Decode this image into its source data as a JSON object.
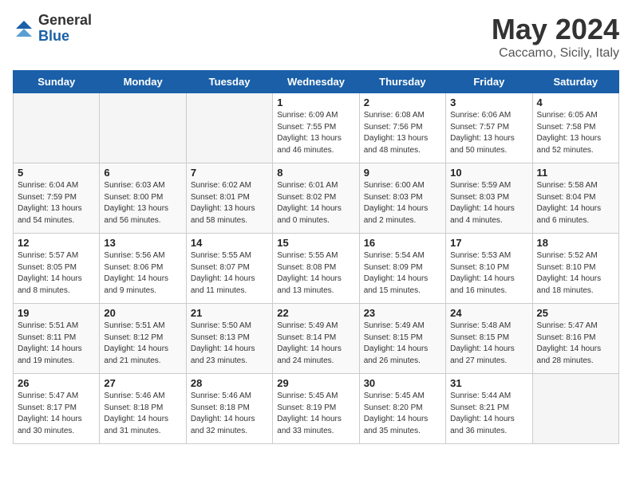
{
  "logo": {
    "general": "General",
    "blue": "Blue"
  },
  "title": "May 2024",
  "subtitle": "Caccamo, Sicily, Italy",
  "headers": [
    "Sunday",
    "Monday",
    "Tuesday",
    "Wednesday",
    "Thursday",
    "Friday",
    "Saturday"
  ],
  "weeks": [
    [
      {
        "day": "",
        "detail": ""
      },
      {
        "day": "",
        "detail": ""
      },
      {
        "day": "",
        "detail": ""
      },
      {
        "day": "1",
        "detail": "Sunrise: 6:09 AM\nSunset: 7:55 PM\nDaylight: 13 hours\nand 46 minutes."
      },
      {
        "day": "2",
        "detail": "Sunrise: 6:08 AM\nSunset: 7:56 PM\nDaylight: 13 hours\nand 48 minutes."
      },
      {
        "day": "3",
        "detail": "Sunrise: 6:06 AM\nSunset: 7:57 PM\nDaylight: 13 hours\nand 50 minutes."
      },
      {
        "day": "4",
        "detail": "Sunrise: 6:05 AM\nSunset: 7:58 PM\nDaylight: 13 hours\nand 52 minutes."
      }
    ],
    [
      {
        "day": "5",
        "detail": "Sunrise: 6:04 AM\nSunset: 7:59 PM\nDaylight: 13 hours\nand 54 minutes."
      },
      {
        "day": "6",
        "detail": "Sunrise: 6:03 AM\nSunset: 8:00 PM\nDaylight: 13 hours\nand 56 minutes."
      },
      {
        "day": "7",
        "detail": "Sunrise: 6:02 AM\nSunset: 8:01 PM\nDaylight: 13 hours\nand 58 minutes."
      },
      {
        "day": "8",
        "detail": "Sunrise: 6:01 AM\nSunset: 8:02 PM\nDaylight: 14 hours\nand 0 minutes."
      },
      {
        "day": "9",
        "detail": "Sunrise: 6:00 AM\nSunset: 8:03 PM\nDaylight: 14 hours\nand 2 minutes."
      },
      {
        "day": "10",
        "detail": "Sunrise: 5:59 AM\nSunset: 8:03 PM\nDaylight: 14 hours\nand 4 minutes."
      },
      {
        "day": "11",
        "detail": "Sunrise: 5:58 AM\nSunset: 8:04 PM\nDaylight: 14 hours\nand 6 minutes."
      }
    ],
    [
      {
        "day": "12",
        "detail": "Sunrise: 5:57 AM\nSunset: 8:05 PM\nDaylight: 14 hours\nand 8 minutes."
      },
      {
        "day": "13",
        "detail": "Sunrise: 5:56 AM\nSunset: 8:06 PM\nDaylight: 14 hours\nand 9 minutes."
      },
      {
        "day": "14",
        "detail": "Sunrise: 5:55 AM\nSunset: 8:07 PM\nDaylight: 14 hours\nand 11 minutes."
      },
      {
        "day": "15",
        "detail": "Sunrise: 5:55 AM\nSunset: 8:08 PM\nDaylight: 14 hours\nand 13 minutes."
      },
      {
        "day": "16",
        "detail": "Sunrise: 5:54 AM\nSunset: 8:09 PM\nDaylight: 14 hours\nand 15 minutes."
      },
      {
        "day": "17",
        "detail": "Sunrise: 5:53 AM\nSunset: 8:10 PM\nDaylight: 14 hours\nand 16 minutes."
      },
      {
        "day": "18",
        "detail": "Sunrise: 5:52 AM\nSunset: 8:10 PM\nDaylight: 14 hours\nand 18 minutes."
      }
    ],
    [
      {
        "day": "19",
        "detail": "Sunrise: 5:51 AM\nSunset: 8:11 PM\nDaylight: 14 hours\nand 19 minutes."
      },
      {
        "day": "20",
        "detail": "Sunrise: 5:51 AM\nSunset: 8:12 PM\nDaylight: 14 hours\nand 21 minutes."
      },
      {
        "day": "21",
        "detail": "Sunrise: 5:50 AM\nSunset: 8:13 PM\nDaylight: 14 hours\nand 23 minutes."
      },
      {
        "day": "22",
        "detail": "Sunrise: 5:49 AM\nSunset: 8:14 PM\nDaylight: 14 hours\nand 24 minutes."
      },
      {
        "day": "23",
        "detail": "Sunrise: 5:49 AM\nSunset: 8:15 PM\nDaylight: 14 hours\nand 26 minutes."
      },
      {
        "day": "24",
        "detail": "Sunrise: 5:48 AM\nSunset: 8:15 PM\nDaylight: 14 hours\nand 27 minutes."
      },
      {
        "day": "25",
        "detail": "Sunrise: 5:47 AM\nSunset: 8:16 PM\nDaylight: 14 hours\nand 28 minutes."
      }
    ],
    [
      {
        "day": "26",
        "detail": "Sunrise: 5:47 AM\nSunset: 8:17 PM\nDaylight: 14 hours\nand 30 minutes."
      },
      {
        "day": "27",
        "detail": "Sunrise: 5:46 AM\nSunset: 8:18 PM\nDaylight: 14 hours\nand 31 minutes."
      },
      {
        "day": "28",
        "detail": "Sunrise: 5:46 AM\nSunset: 8:18 PM\nDaylight: 14 hours\nand 32 minutes."
      },
      {
        "day": "29",
        "detail": "Sunrise: 5:45 AM\nSunset: 8:19 PM\nDaylight: 14 hours\nand 33 minutes."
      },
      {
        "day": "30",
        "detail": "Sunrise: 5:45 AM\nSunset: 8:20 PM\nDaylight: 14 hours\nand 35 minutes."
      },
      {
        "day": "31",
        "detail": "Sunrise: 5:44 AM\nSunset: 8:21 PM\nDaylight: 14 hours\nand 36 minutes."
      },
      {
        "day": "",
        "detail": ""
      }
    ]
  ]
}
